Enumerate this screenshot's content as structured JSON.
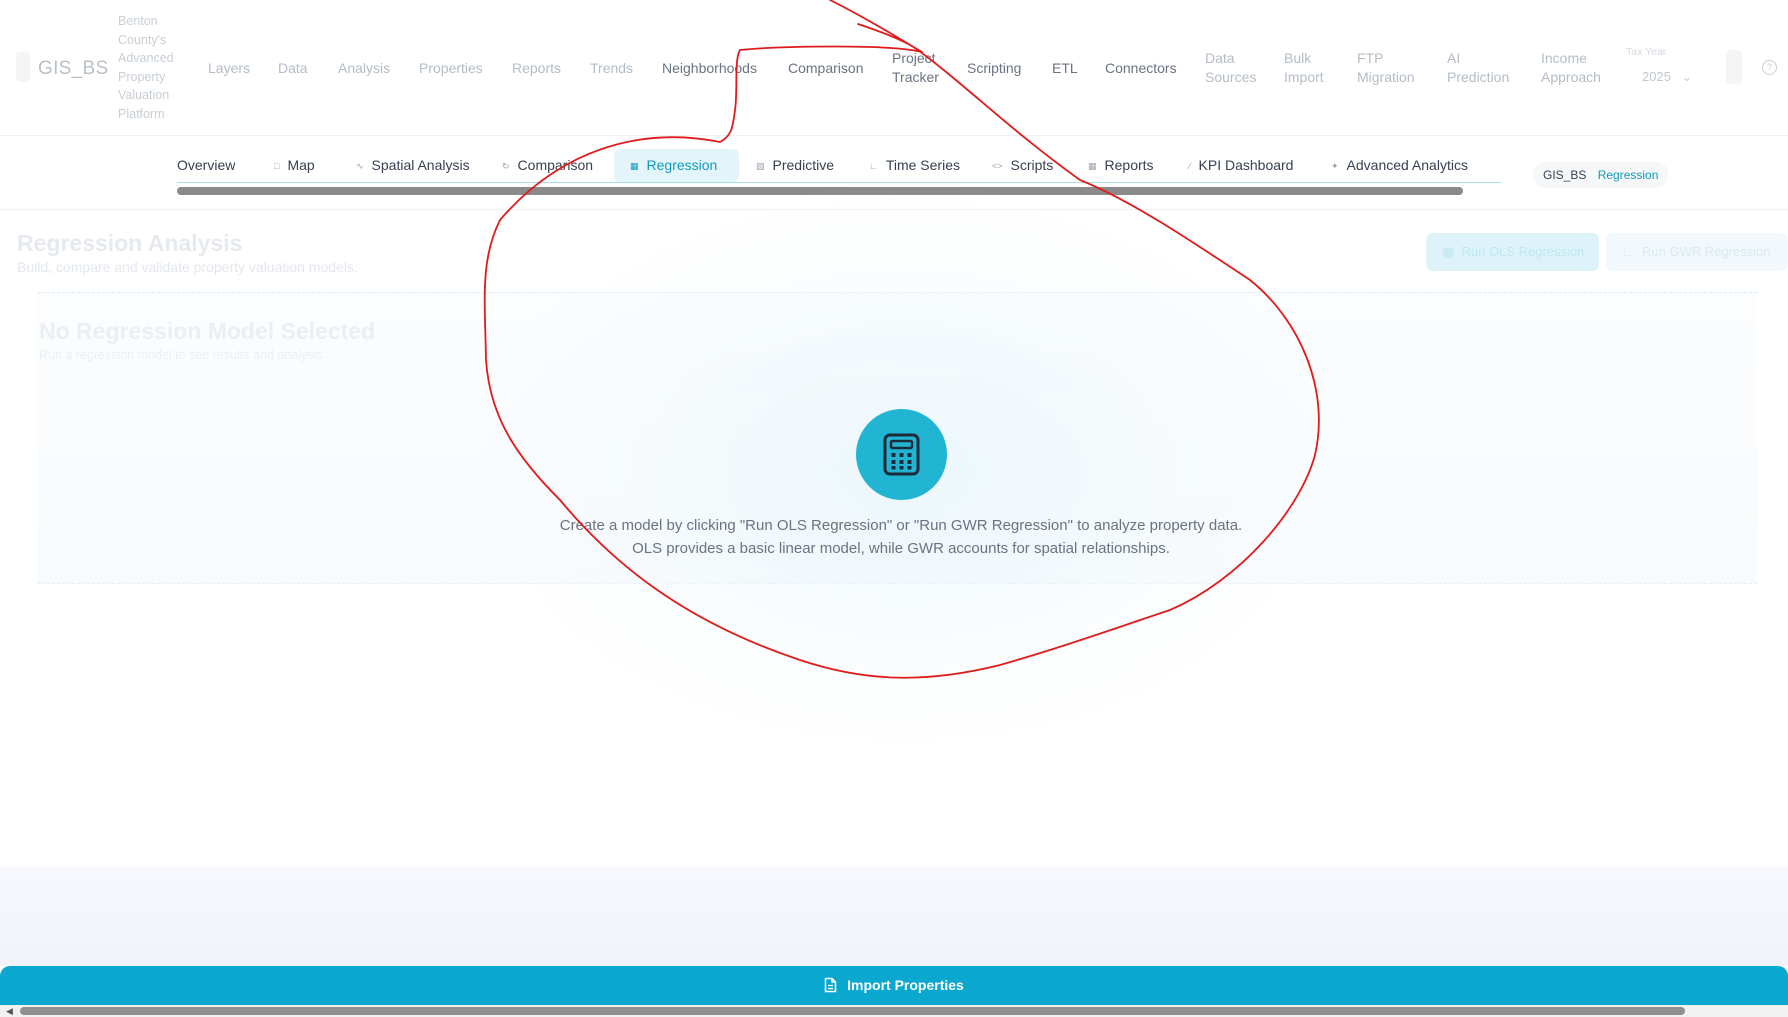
{
  "header": {
    "brand": "GIS_BS",
    "brand_subtitle": "Benton County's Advanced Property Valuation Platform",
    "nav": {
      "layers": "Layers",
      "data": "Data",
      "analysis": "Analysis",
      "properties": "Properties",
      "reports": "Reports",
      "trends": "Trends",
      "neighborhoods": "Neighborhoods",
      "comparison": "Comparison",
      "project_tracker": "Project Tracker",
      "scripting": "Scripting",
      "etl": "ETL",
      "connectors": "Connectors",
      "data_sources": "Data Sources",
      "bulk_import": "Bulk Import",
      "ftp_migration": "FTP Migration",
      "ai_prediction": "AI Prediction",
      "income_approach": "Income Approach"
    },
    "tax_year_label": "Tax Year",
    "tax_year_value": "2025"
  },
  "tabs": {
    "overview": "Overview",
    "map": "Map",
    "spatial_analysis": "Spatial Analysis",
    "comparison": "Comparison",
    "regression": "Regression",
    "predictive": "Predictive",
    "time_series": "Time Series",
    "scripts": "Scripts",
    "reports": "Reports",
    "kpi_dashboard": "KPI Dashboard",
    "advanced_analytics": "Advanced Analytics",
    "active": "Regression"
  },
  "breadcrumb": {
    "root": "GIS_BS",
    "current": "Regression"
  },
  "page": {
    "title": "Regression Analysis",
    "subtitle": "Build, compare and validate property valuation models.",
    "run_ols_label": "Run OLS Regression",
    "run_gwr_label": "Run GWR Regression"
  },
  "empty_state": {
    "title": "No Regression Model Selected",
    "subtitle": "Run a regression model to see results and analysis.",
    "message_line1": "Create a model by clicking \"Run OLS Regression\" or \"Run GWR Regression\" to analyze property data.",
    "message_line2": "OLS provides a basic linear model, while GWR accounts for spatial relationships.",
    "icon": "calculator-icon"
  },
  "footer": {
    "import_label": "Import Properties",
    "import_icon": "document-icon"
  },
  "colors": {
    "accent": "#0aa8cf",
    "active_tab_text": "#0e9bc0",
    "calc_circle": "#22b5d3",
    "annotation": "#e01b1b"
  }
}
